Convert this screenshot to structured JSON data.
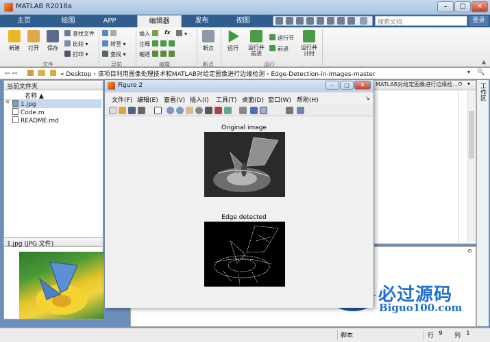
{
  "window": {
    "title": "MATLAB R2018a",
    "minimize": "–",
    "maximize": "□",
    "close": "✕"
  },
  "tabs": [
    "主页",
    "绘图",
    "APP",
    "编辑器",
    "发布",
    "视图"
  ],
  "search": {
    "placeholder": "搜索文档"
  },
  "login": "登录",
  "ribbon": {
    "file": {
      "new": "新建",
      "open": "打开",
      "save": "保存",
      "find_files": "查找文件",
      "compare": "比较",
      "print": "打印",
      "group": "文件"
    },
    "nav": {
      "goto": "转至",
      "find": "查找",
      "group": "导航"
    },
    "edit": {
      "insert": "插入",
      "comment": "注释",
      "indent": "缩进",
      "fx": "fx",
      "group": "编辑"
    },
    "breakpoints": {
      "label": "断点",
      "group": "断点"
    },
    "run": {
      "run": "运行",
      "run_advance": "运行并\n前进",
      "run_section": "运行节",
      "advance": "前进",
      "run_time": "运行并\n计时",
      "group": "运行"
    }
  },
  "address": {
    "path": "«  Desktop  ›  该项目利用图像处理技术和MATLAB对给定图像进行边缘检测  ›  Edge-Detection-in-Images-master"
  },
  "current_folder": {
    "title": "当前文件夹",
    "column": "名称 ▲",
    "files": [
      "1.jpg",
      "Code.m",
      "README.md"
    ]
  },
  "preview": {
    "label": "1.jpg  (JPG 文件)"
  },
  "workspace_strip": "工作区",
  "editor_tab": "MATLAB对给定图像进行边缘检...",
  "figure": {
    "title": "Figure 2",
    "menu": [
      "文件(F)",
      "编辑(E)",
      "查看(V)",
      "插入(I)",
      "工具(T)",
      "桌面(D)",
      "窗口(W)",
      "帮助(H)"
    ],
    "axes": [
      {
        "title": "Original image"
      },
      {
        "title": "Edge detected"
      }
    ]
  },
  "status": {
    "mode": "脚本",
    "row_label": "行",
    "row": "9",
    "col_label": "列",
    "col": "1"
  },
  "watermark": {
    "brand": "必过源码",
    "url": "Biguo100.com"
  }
}
